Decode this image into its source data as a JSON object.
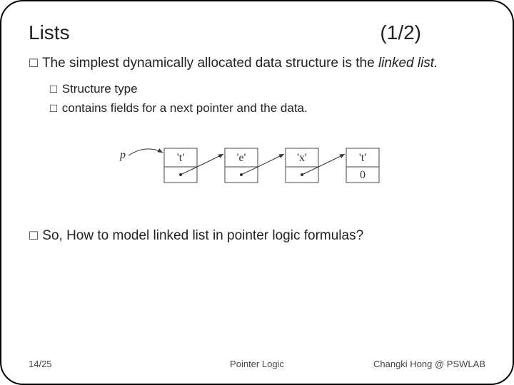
{
  "header": {
    "title": "Lists",
    "counter": "(1/2)"
  },
  "bullet1": {
    "pre": "The simplest dynamically allocated data structure is the ",
    "em": "linked list.",
    "post": ""
  },
  "sub1": "Structure type",
  "sub2": "contains fields for a next pointer and the data.",
  "diagram": {
    "p": "p",
    "nodes": [
      "'t'",
      "'e'",
      "'x'",
      "'t'"
    ],
    "last": "0"
  },
  "question": "So, How to model linked list in pointer logic formulas?",
  "footer": {
    "left": "14/25",
    "center": "Pointer Logic",
    "right": "Changki Hong @ PSWLAB"
  },
  "glyph": {
    "box": "□"
  }
}
